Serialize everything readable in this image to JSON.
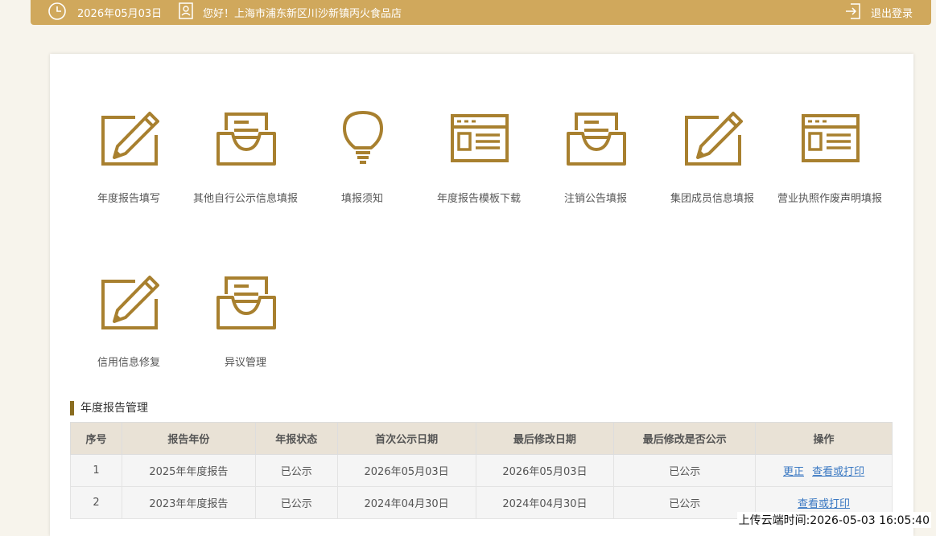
{
  "header": {
    "date": "2026年05月03日",
    "greeting": "您好！上海市浦东新区川沙新镇丙火食品店",
    "logout_label": "退出登录"
  },
  "tiles": [
    {
      "label": "年度报告填写",
      "icon": "pencil-edit-icon"
    },
    {
      "label": "其他自行公示信息填报",
      "icon": "inbox-tray-icon"
    },
    {
      "label": "填报须知",
      "icon": "lightbulb-icon"
    },
    {
      "label": "年度报告模板下载",
      "icon": "template-window-icon"
    },
    {
      "label": "注销公告填报",
      "icon": "inbox-tray-icon"
    },
    {
      "label": "集团成员信息填报",
      "icon": "pencil-edit-icon"
    },
    {
      "label": "营业执照作废声明填报",
      "icon": "template-window-icon"
    },
    {
      "label": "信用信息修复",
      "icon": "pencil-edit-icon"
    },
    {
      "label": "异议管理",
      "icon": "inbox-tray-icon"
    }
  ],
  "section": {
    "title": "年度报告管理"
  },
  "table": {
    "headers": [
      "序号",
      "报告年份",
      "年报状态",
      "首次公示日期",
      "最后修改日期",
      "最后修改是否公示",
      "操作"
    ],
    "rows": [
      {
        "no": "1",
        "year": "2025年年度报告",
        "status": "已公示",
        "first_date": "2026年05月03日",
        "last_date": "2026年05月03日",
        "last_public": "已公示",
        "actions": [
          "更正",
          "查看或打印"
        ]
      },
      {
        "no": "2",
        "year": "2023年年度报告",
        "status": "已公示",
        "first_date": "2024年04月30日",
        "last_date": "2024年04月30日",
        "last_public": "已公示",
        "actions": [
          "查看或打印"
        ]
      }
    ]
  },
  "footer": {
    "upload_time": "上传云端时间:2026-05-03 16:05:40"
  },
  "colors": {
    "accent": "#d0a85c",
    "icon": "#a8802f",
    "header_bg": "#e9e2d6",
    "link": "#3a78c2"
  }
}
